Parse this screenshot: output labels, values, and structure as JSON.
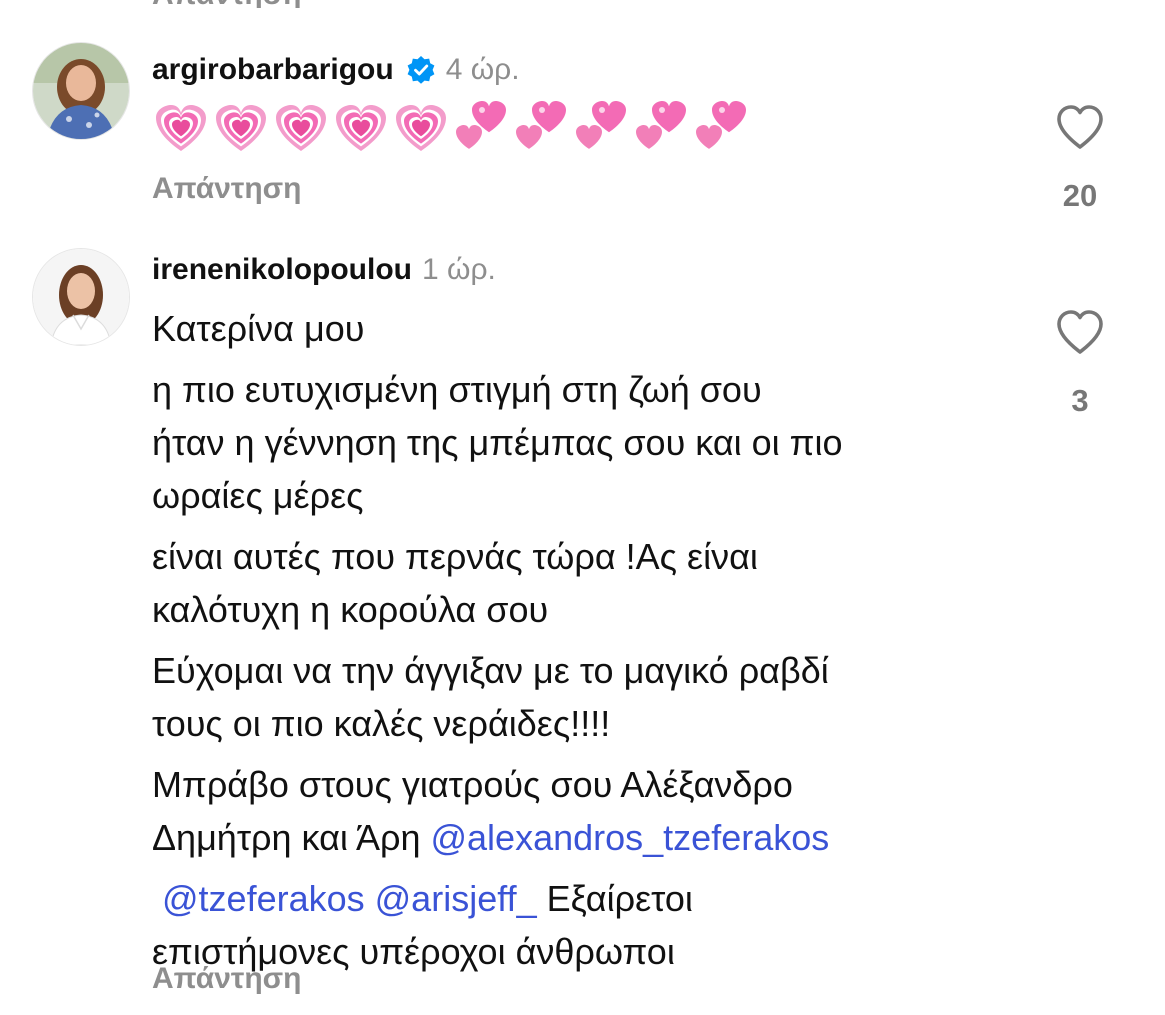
{
  "cut_top_text": "Απάντηση",
  "comments": [
    {
      "username": "argirobarbarigou",
      "verified": true,
      "time": "4 ώρ.",
      "emojis": [
        "heart-pulse",
        "heart-pulse",
        "heart-pulse",
        "heart-pulse",
        "heart-pulse",
        "two-hearts",
        "two-hearts",
        "two-hearts",
        "two-hearts",
        "two-hearts"
      ],
      "reply_label": "Απάντηση",
      "like_count": "20"
    },
    {
      "username": "irenenikolopoulou",
      "verified": false,
      "time": "1 ώρ.",
      "paragraphs": [
        [
          "Κατερίνα μου"
        ],
        [
          "η  πιο ευτυχισμένη στιγμή στη ζωή σου",
          "ήταν η γέννηση της μπέμπας σου και οι πιο",
          "ωραίες μέρες"
        ],
        [
          "είναι αυτές που περνάς τώρα !Ας είναι",
          "καλότυχη η κορούλα σου"
        ],
        [
          "Εύχομαι να  την άγγιξαν με το μαγικό ραβδί",
          "τους οι πιο καλές νεράιδες!!!!"
        ],
        [
          "Μπράβο στους γιατρούς σου Αλέξανδρο",
          "Δημήτρη και Άρη "
        ]
      ],
      "mentions": [
        "@alexandros_tzeferakos",
        "@tzeferakos",
        "@arisjeff_"
      ],
      "closing_text": "Εξαίρετοι",
      "closing_line_2": "επιστήμονες υπέροχοι άνθρωποι",
      "reply_label": "Απάντηση",
      "like_count": "3"
    }
  ],
  "colors": {
    "mention": "#3a53d6",
    "muted": "#8e8e8e",
    "verified": "#0095f6",
    "emoji_pink": "#f36bb5"
  },
  "icons": {
    "like": "heart-outline-icon",
    "verified": "verified-badge-icon"
  }
}
